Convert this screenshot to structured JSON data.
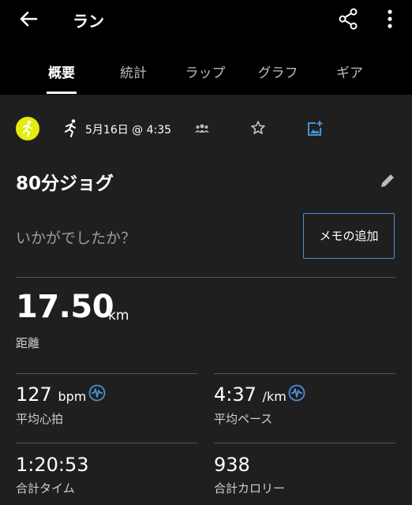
{
  "appbar": {
    "title": "ラン"
  },
  "tabs": [
    "概要",
    "統計",
    "ラップ",
    "グラフ",
    "ギア"
  ],
  "activity": {
    "date": "5月16日 @ 4:35",
    "name": "80分ジョグ",
    "feel_prompt": "いかがでしたか？",
    "memo_button": "メモの追加"
  },
  "distance": {
    "value": "17.50",
    "unit": "km",
    "label": "距離"
  },
  "stats": {
    "heart": {
      "value": "127",
      "unit": "bpm",
      "label": "平均心拍"
    },
    "pace": {
      "value": "4:37",
      "unit": "/km",
      "label": "平均ペース"
    },
    "time": {
      "value": "1:20:53",
      "label": "合計タイム"
    },
    "calories": {
      "value": "938",
      "label": "合計カロリー"
    }
  },
  "colors": {
    "accent": "#4a90d9",
    "avatar": "#e3ec0d",
    "background": "#1f1f1f",
    "header": "#000000"
  },
  "icons": [
    "back-arrow-icon",
    "share-icon",
    "more-vert-icon",
    "runner-icon",
    "group-icon",
    "star-icon",
    "add-photo-icon",
    "pencil-icon",
    "pulse-icon"
  ]
}
